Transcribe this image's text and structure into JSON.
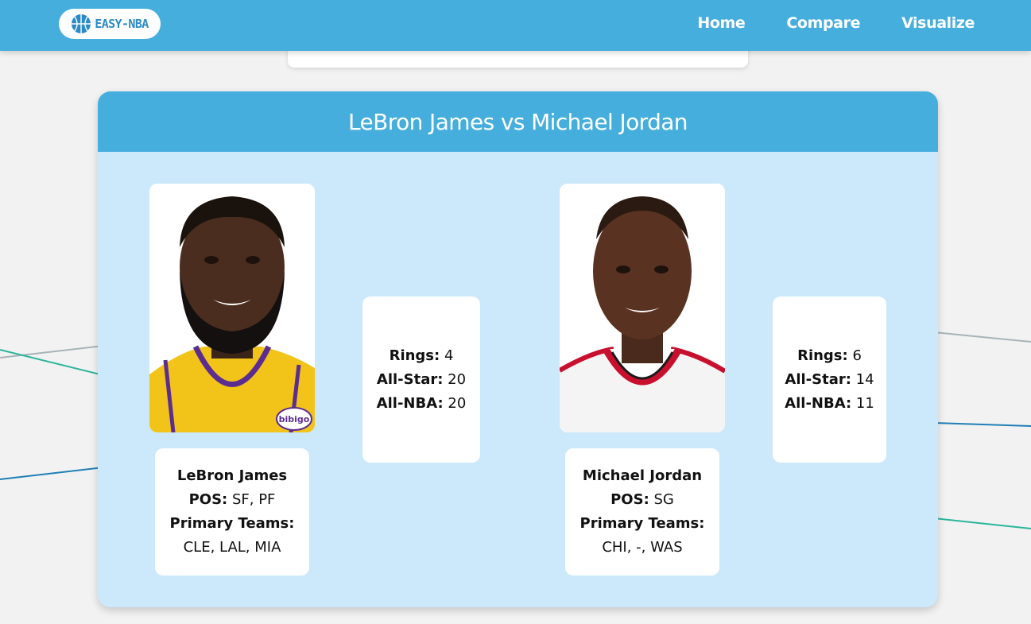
{
  "nav": {
    "logo_text": "EASY-NBA",
    "links": [
      "Home",
      "Compare",
      "Visualize"
    ]
  },
  "compare": {
    "title": "LeBron James vs Michael Jordan",
    "players": [
      {
        "name": "LeBron James",
        "pos_label": "POS:",
        "pos": "SF, PF",
        "teams_label": "Primary Teams:",
        "teams": "CLE, LAL, MIA",
        "rings_label": "Rings:",
        "rings": "4",
        "allstar_label": "All-Star:",
        "allstar": "20",
        "allnba_label": "All-NBA:",
        "allnba": "20",
        "jersey_text": "bibigo"
      },
      {
        "name": "Michael Jordan",
        "pos_label": "POS:",
        "pos": "SG",
        "teams_label": "Primary Teams:",
        "teams": "CHI, -, WAS",
        "rings_label": "Rings:",
        "rings": "6",
        "allstar_label": "All-Star:",
        "allstar": "14",
        "allnba_label": "All-NBA:",
        "allnba": "11"
      }
    ]
  },
  "colors": {
    "nav_bg": "#46aedd",
    "card_bg": "#cce8fb",
    "page_bg": "#f2f2f2",
    "logo_blue": "#2b8bc6"
  },
  "icons": {
    "logo": "basketball-icon"
  }
}
